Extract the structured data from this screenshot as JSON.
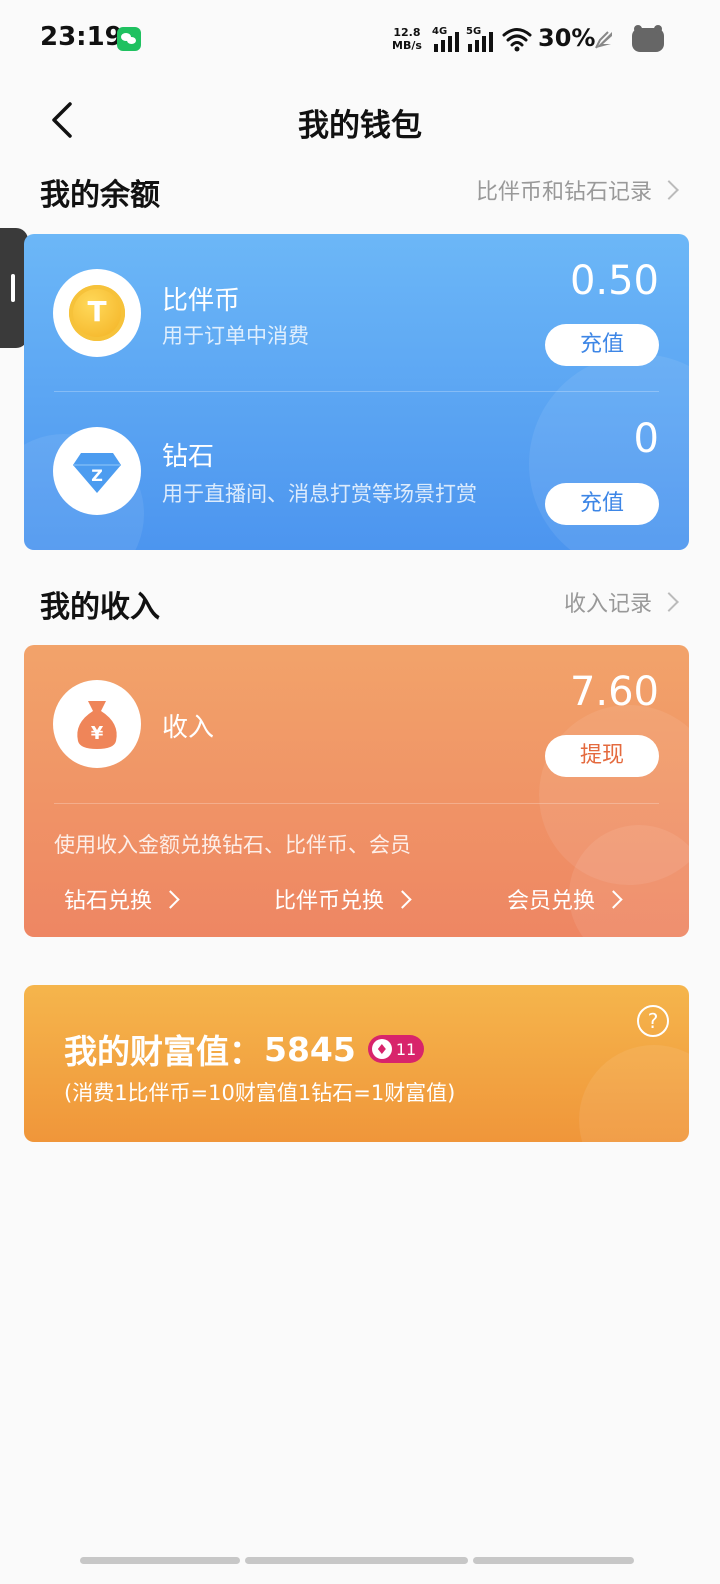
{
  "status_bar": {
    "time": "23:19",
    "net_speed_value": "12.8",
    "net_speed_unit": "MB/s",
    "signal_1": "4G",
    "signal_2": "5G",
    "battery": "30%",
    "icons": [
      "wechat-icon",
      "signal-icon",
      "wifi-icon",
      "charging-icon",
      "face-icon"
    ]
  },
  "header": {
    "title": "我的钱包",
    "back_icon": "back-icon"
  },
  "balance": {
    "section_title": "我的余额",
    "record_link": "比伴币和钻石记录",
    "coin": {
      "name": "比伴币",
      "description": "用于订单中消费",
      "amount": "0.50",
      "button": "充值",
      "icon_glyph": "T"
    },
    "diamond": {
      "name": "钻石",
      "description": "用于直播间、消息打赏等场景打赏",
      "amount": "0",
      "button": "充值",
      "icon_glyph": "Z"
    }
  },
  "income": {
    "section_title": "我的收入",
    "record_link": "收入记录",
    "name": "收入",
    "amount": "7.60",
    "button": "提现",
    "icon_glyph": "¥",
    "note": "使用收入金额兑换钻石、比伴币、会员",
    "exchanges": [
      "钻石兑换",
      "比伴币兑换",
      "会员兑换"
    ]
  },
  "wealth": {
    "label": "我的财富值：",
    "value": "5845",
    "level": "11",
    "note": "(消费1比伴币=10财富值1钻石=1财富值)",
    "help": "?"
  },
  "colors": {
    "balance_card": "#4c95ef",
    "income_card": "#ee8663",
    "wealth_card": "#f0963a",
    "level_badge": "#d8246b"
  }
}
